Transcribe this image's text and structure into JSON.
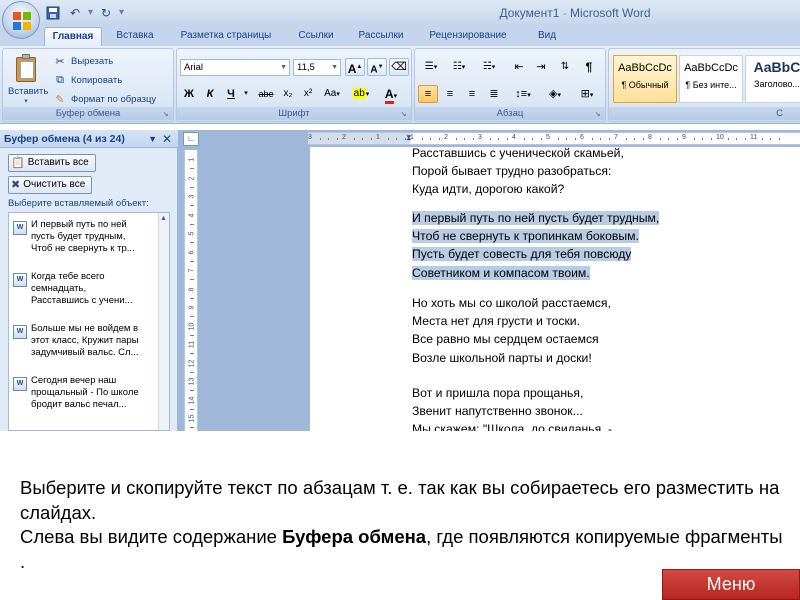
{
  "window": {
    "title": "Документ1",
    "app": "Microsoft Word",
    "title_sep": " - "
  },
  "qat": {
    "undo_icon": "undo-icon",
    "redo_icon": "redo-icon",
    "save_icon": "save-icon",
    "more": "▾"
  },
  "tabs": [
    "Главная",
    "Вставка",
    "Разметка страницы",
    "Ссылки",
    "Рассылки",
    "Рецензирование",
    "Вид"
  ],
  "ribbon": {
    "clipboard": {
      "paste": "Вставить",
      "cut": "Вырезать",
      "copy": "Копировать",
      "format_painter": "Формат по образцу",
      "label": "Буфер обмена"
    },
    "font": {
      "name": "Arial",
      "size": "11,5",
      "grow": "A",
      "shrink": "A",
      "bold": "Ж",
      "italic": "К",
      "underline": "Ч",
      "strike": "abe",
      "sub": "x₂",
      "sup": "x²",
      "case": "Aa",
      "label": "Шрифт"
    },
    "paragraph": {
      "label": "Абзац"
    },
    "styles": {
      "items": [
        {
          "sample": "AaBbCcDc",
          "name": "¶ Обычный"
        },
        {
          "sample": "AaBbCcDc",
          "name": "¶ Без инте..."
        },
        {
          "sample": "AaBbC",
          "name": "Заголово..."
        }
      ],
      "label": "С"
    }
  },
  "clipboard_pane": {
    "title": "Буфер обмена (4 из 24)",
    "paste_all": "Вставить все",
    "clear_all": "Очистить все",
    "hint": "Выберите вставляемый объект:",
    "items": [
      [
        "И первый путь по ней",
        "пусть будет трудным,",
        "Чтоб не свернуть к тр..."
      ],
      [
        "Когда тебе всего",
        "семнадцать,",
        "Расставшись с учени..."
      ],
      [
        "Больше мы не войдем в",
        "этот класс, Кружит пары",
        "задумчивый вальс. Сл..."
      ],
      [
        "Сегодня вечер наш",
        "прощальный - По школе",
        "бродит вальс печал..."
      ]
    ]
  },
  "ruler": {
    "h_numbers": [
      "3",
      "2",
      "1",
      "1",
      "2",
      "3",
      "4",
      "5",
      "6",
      "7",
      "8",
      "9",
      "10",
      "11"
    ],
    "v_numbers": [
      "1",
      "2",
      "3",
      "4",
      "5",
      "6",
      "7",
      "8",
      "9",
      "10",
      "11",
      "12",
      "13",
      "14",
      "15"
    ]
  },
  "document": {
    "block1": [
      "Расставшись с ученической скамьей,",
      "Порой бывает трудно разобраться:",
      "Куда идти, дорогою какой?"
    ],
    "block2": [
      "И первый  путь по ней пусть будет трудным,",
      "Чтоб не свернуть к тропинкам  боковым.",
      "Пусть будет совесть для тебя повсюду",
      "Советником и компасом  твоим."
    ],
    "block3": [
      "Но хоть мы со школой расстаемся,",
      "Места нет для грусти и тоски.",
      "Все равно мы сердцем остаемся",
      "Возле школьной парты и доски!"
    ],
    "block4": [
      "Вот и пришла пора  прощанья,",
      "Звенит напутственно  звонок...",
      "Мы скажем: \"Школа, до свиданья,  -"
    ]
  },
  "caption": {
    "line1": "Выберите и скопируйте текст по абзацам т. е.  так как вы собираетесь его разместить на слайдах.",
    "line2_pre": "Слева вы видите содержание ",
    "line2_bold": "Буфера обмена",
    "line2_post": ", где появляются копируемые фрагменты ."
  },
  "menu_button": "Меню",
  "colors": {
    "highlight": "#b8cce4",
    "menu_red": "#c5332b",
    "ribbon_blue": "#d7e4f4"
  }
}
